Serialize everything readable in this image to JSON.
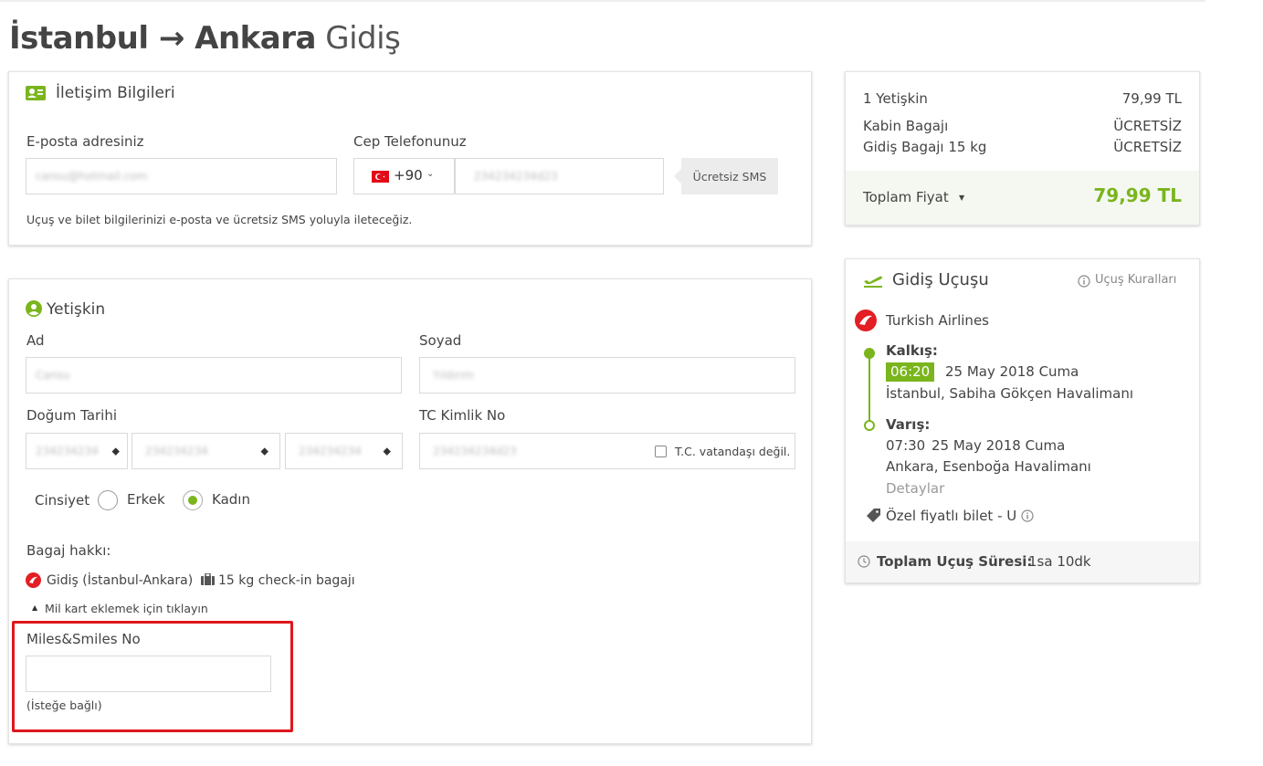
{
  "page": {
    "title_route": "İstanbul → Ankara",
    "title_direction": "Gidiş"
  },
  "contact": {
    "heading": "İletişim Bilgileri",
    "email_label": "E-posta adresiniz",
    "email_value": "cansu@hotmail.com",
    "phone_label": "Cep Telefonunuz",
    "country_code": "+90",
    "phone_value": "234234234d23",
    "sms_button": "Ücretsiz SMS",
    "note": "Uçuş ve bilet bilgilerinizi e-posta ve ücretsiz SMS yoluyla ileteceğiz."
  },
  "passenger": {
    "heading": "Yetişkin",
    "first_name_label": "Ad",
    "first_name_value": "Cansu",
    "last_name_label": "Soyad",
    "last_name_value": "Yıldırım",
    "dob_label": "Doğum Tarihi",
    "dob_day": "234234234",
    "dob_month": "234234234",
    "dob_year": "234234234",
    "tc_label": "TC Kimlik No",
    "tc_value": "234234234d23",
    "tc_not_citizen": "T.C. vatandaşı değil.",
    "gender_label": "Cinsiyet",
    "gender_male": "Erkek",
    "gender_female": "Kadın",
    "baggage_label": "Bagaj hakkı:",
    "baggage_route": "Gidiş (İstanbul-Ankara)",
    "baggage_allowance": "15 kg check-in bagajı",
    "miles_toggle": "Mil kart eklemek için tıklayın",
    "miles_label": "Miles&Smiles No",
    "miles_value": "",
    "miles_optional": "(İsteğe bağlı)"
  },
  "price_summary": {
    "rows": [
      {
        "label": "1 Yetişkin",
        "value": "79,99 TL"
      },
      {
        "label": "Kabin Bagajı",
        "value": "ÜCRETSİZ"
      },
      {
        "label": "Gidiş Bagajı 15 kg",
        "value": "ÜCRETSİZ"
      }
    ],
    "total_label": "Toplam Fiyat",
    "total_value": "79,99 TL"
  },
  "flight": {
    "heading": "Gidiş Uçuşu",
    "rules_link": "Uçuş Kuralları",
    "airline": "Turkish Airlines",
    "departure_label": "Kalkış:",
    "departure_time": "06:20",
    "departure_date": "25 May 2018 Cuma",
    "departure_airport": "İstanbul, Sabiha Gökçen Havalimanı",
    "arrival_label": "Varış:",
    "arrival_time": "07:30",
    "arrival_date": "25 May 2018 Cuma",
    "arrival_airport": "Ankara, Esenboğa Havalimanı",
    "details_link": "Detaylar",
    "fare_type": "Özel fiyatlı bilet - U",
    "duration_label": "Toplam Uçuş Süresi:",
    "duration_value": "1sa 10dk"
  },
  "colors": {
    "accent": "#7ab51d",
    "highlight": "#e0161e",
    "airline_red": "#e31e24"
  }
}
